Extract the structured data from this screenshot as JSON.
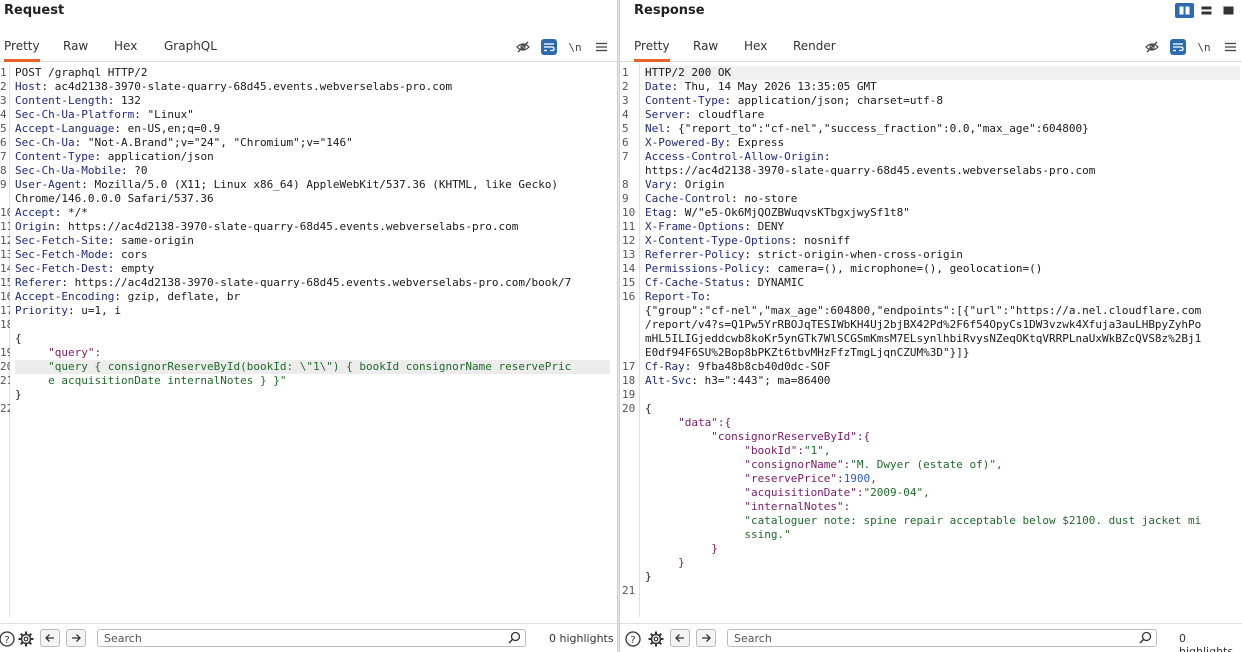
{
  "request": {
    "title": "Request",
    "tabs": [
      "Pretty",
      "Raw",
      "Hex",
      "GraphQL"
    ],
    "active_tab": "Pretty",
    "line_numbers": [
      "1",
      "2",
      "3",
      "4",
      "5",
      "6",
      "7",
      "8",
      "9",
      "",
      "10",
      "11",
      "12",
      "13",
      "14",
      "15",
      "16",
      "17",
      "18",
      "",
      "19",
      "20",
      "21",
      "",
      "22"
    ],
    "lines": [
      {
        "k": "",
        "v": "POST /graphql HTTP/2"
      },
      {
        "k": "Host",
        "v": ": ac4d2138-3970-slate-quarry-68d45.events.webverselabs-pro.com"
      },
      {
        "k": "Content-Length",
        "v": ": 132"
      },
      {
        "k": "Sec-Ch-Ua-Platform",
        "v": ": \"Linux\""
      },
      {
        "k": "Accept-Language",
        "v": ": en-US,en;q=0.9"
      },
      {
        "k": "Sec-Ch-Ua",
        "v": ": \"Not-A.Brand\";v=\"24\", \"Chromium\";v=\"146\""
      },
      {
        "k": "Content-Type",
        "v": ": application/json"
      },
      {
        "k": "Sec-Ch-Ua-Mobile",
        "v": ": ?0"
      },
      {
        "k": "User-Agent",
        "v": ": Mozilla/5.0 (X11; Linux x86_64) AppleWebKit/537.36 (KHTML, like Gecko)"
      },
      {
        "k": "",
        "v": "Chrome/146.0.0.0 Safari/537.36"
      },
      {
        "k": "Accept",
        "v": ": */*"
      },
      {
        "k": "Origin",
        "v": ": https://ac4d2138-3970-slate-quarry-68d45.events.webverselabs-pro.com"
      },
      {
        "k": "Sec-Fetch-Site",
        "v": ": same-origin"
      },
      {
        "k": "Sec-Fetch-Mode",
        "v": ": cors"
      },
      {
        "k": "Sec-Fetch-Dest",
        "v": ": empty"
      },
      {
        "k": "Referer",
        "v": ": https://ac4d2138-3970-slate-quarry-68d45.events.webverselabs-pro.com/book/7"
      },
      {
        "k": "Accept-Encoding",
        "v": ": gzip, deflate, br"
      },
      {
        "k": "Priority",
        "v": ": u=1, i"
      },
      {
        "k": "",
        "v": ""
      },
      {
        "k": "",
        "v": "{"
      },
      {
        "k": "",
        "v": "     \"query\":",
        "cls": "jk"
      },
      {
        "k": "",
        "v": "     \"query { consignorReserveById(bookId: \\\"1\\\") { bookId consignorName reservePric",
        "cls": "js",
        "hl": true
      },
      {
        "k": "",
        "v": "     e acquisitionDate internalNotes } }\"",
        "cls": "js"
      },
      {
        "k": "",
        "v": "}"
      }
    ],
    "search_placeholder": "Search",
    "highlights": "0 highlights"
  },
  "response": {
    "title": "Response",
    "tabs": [
      "Pretty",
      "Raw",
      "Hex",
      "Render"
    ],
    "active_tab": "Pretty",
    "line_numbers": [
      "1",
      "2",
      "3",
      "4",
      "5",
      "6",
      "7",
      "",
      "8",
      "9",
      "10",
      "11",
      "12",
      "13",
      "14",
      "15",
      "16",
      "",
      "",
      "",
      "",
      "17",
      "18",
      "19",
      "20",
      "",
      "",
      "",
      "",
      "",
      "",
      "",
      "",
      "",
      "",
      "",
      "",
      "21"
    ],
    "lines": [
      {
        "k": "",
        "v": "HTTP/2 200 OK"
      },
      {
        "k": "Date",
        "v": ": Thu, 14 May 2026 13:35:05 GMT"
      },
      {
        "k": "Content-Type",
        "v": ": application/json; charset=utf-8"
      },
      {
        "k": "Server",
        "v": ": cloudflare"
      },
      {
        "k": "Nel",
        "v": ": {\"report_to\":\"cf-nel\",\"success_fraction\":0.0,\"max_age\":604800}"
      },
      {
        "k": "X-Powered-By",
        "v": ": Express"
      },
      {
        "k": "Access-Control-Allow-Origin",
        "v": ":"
      },
      {
        "k": "",
        "v": "https://ac4d2138-3970-slate-quarry-68d45.events.webverselabs-pro.com"
      },
      {
        "k": "Vary",
        "v": ": Origin"
      },
      {
        "k": "Cache-Control",
        "v": ": no-store"
      },
      {
        "k": "Etag",
        "v": ": W/\"e5-Ok6MjQOZBWuqvsKTbgxjwySf1t8\""
      },
      {
        "k": "X-Frame-Options",
        "v": ": DENY"
      },
      {
        "k": "X-Content-Type-Options",
        "v": ": nosniff"
      },
      {
        "k": "Referrer-Policy",
        "v": ": strict-origin-when-cross-origin"
      },
      {
        "k": "Permissions-Policy",
        "v": ": camera=(), microphone=(), geolocation=()"
      },
      {
        "k": "Cf-Cache-Status",
        "v": ": DYNAMIC"
      },
      {
        "k": "Report-To",
        "v": ":"
      },
      {
        "k": "",
        "v": "{\"group\":\"cf-nel\",\"max_age\":604800,\"endpoints\":[{\"url\":\"https://a.nel.cloudflare.com"
      },
      {
        "k": "",
        "v": "/report/v4?s=Q1Pw5YrRBOJqTESIWbKH4Uj2bjBX42Pd%2F6f54OpyCs1DW3vzwk4Xfuja3auLHBpyZyhPo"
      },
      {
        "k": "",
        "v": "mHL5ILIGjeddcwb8koKr5ynGTk7WlSCGSmKmsM7ELsynlhbiRvysNZeqOKtqVRRPLnaUxWkBZcQVS8z%2Bj1"
      },
      {
        "k": "",
        "v": "E0df94F6SU%2Bop8bPKZt6tbvMHzFfzTmgLjqnCZUM%3D\"}]}"
      },
      {
        "k": "Cf-Ray",
        "v": ": 9fba48b8cb40d0dc-SOF"
      },
      {
        "k": "Alt-Svc",
        "v": ": h3=\":443\"; ma=86400"
      },
      {
        "k": "",
        "v": ""
      },
      {
        "k": "",
        "v": "{"
      },
      {
        "k": "",
        "v": "     \"data\":{",
        "cls": "jk"
      },
      {
        "k": "",
        "v": "          \"consignorReserveById\":{",
        "cls": "jk"
      },
      {
        "k": "",
        "v": "               \"bookId\":\"1\",",
        "cls": "mixed",
        "parts": [
          [
            "jk",
            "               \"bookId\":"
          ],
          [
            "js",
            "\"1\","
          ]
        ]
      },
      {
        "k": "",
        "v": "               \"consignorName\":\"M. Dwyer (estate of)\",",
        "cls": "mixed",
        "parts": [
          [
            "jk",
            "               \"consignorName\":"
          ],
          [
            "js",
            "\"M. Dwyer (estate of)\","
          ]
        ]
      },
      {
        "k": "",
        "v": "               \"reservePrice\":1900,",
        "cls": "mixed",
        "parts": [
          [
            "jk",
            "               \"reservePrice\":"
          ],
          [
            "jn",
            "1900"
          ],
          [
            "jk",
            ","
          ]
        ]
      },
      {
        "k": "",
        "v": "               \"acquisitionDate\":\"2009-04\",",
        "cls": "mixed",
        "parts": [
          [
            "jk",
            "               \"acquisitionDate\":"
          ],
          [
            "js",
            "\"2009-04\","
          ]
        ]
      },
      {
        "k": "",
        "v": "               \"internalNotes\":",
        "cls": "jk"
      },
      {
        "k": "",
        "v": "               \"cataloguer note: spine repair acceptable below $2100. dust jacket mi",
        "cls": "js"
      },
      {
        "k": "",
        "v": "               ssing.\"",
        "cls": "js"
      },
      {
        "k": "",
        "v": "          }",
        "cls": "jk"
      },
      {
        "k": "",
        "v": "     }",
        "cls": "jk"
      },
      {
        "k": "",
        "v": "}"
      },
      {
        "k": "",
        "v": ""
      }
    ],
    "search_placeholder": "Search",
    "highlights": "0 highlights"
  },
  "icons": {
    "hide": "eye-slash-icon",
    "wrap": "wrap-lines-icon",
    "newline": "\\n",
    "menu": "hamburger-menu-icon",
    "help": "help-icon",
    "settings": "gear-icon",
    "back": "arrow-left-icon",
    "forward": "arrow-right-icon",
    "search": "search-icon"
  },
  "colors": {
    "accent": "#e8622a",
    "toggle": "#2b6cb0"
  }
}
